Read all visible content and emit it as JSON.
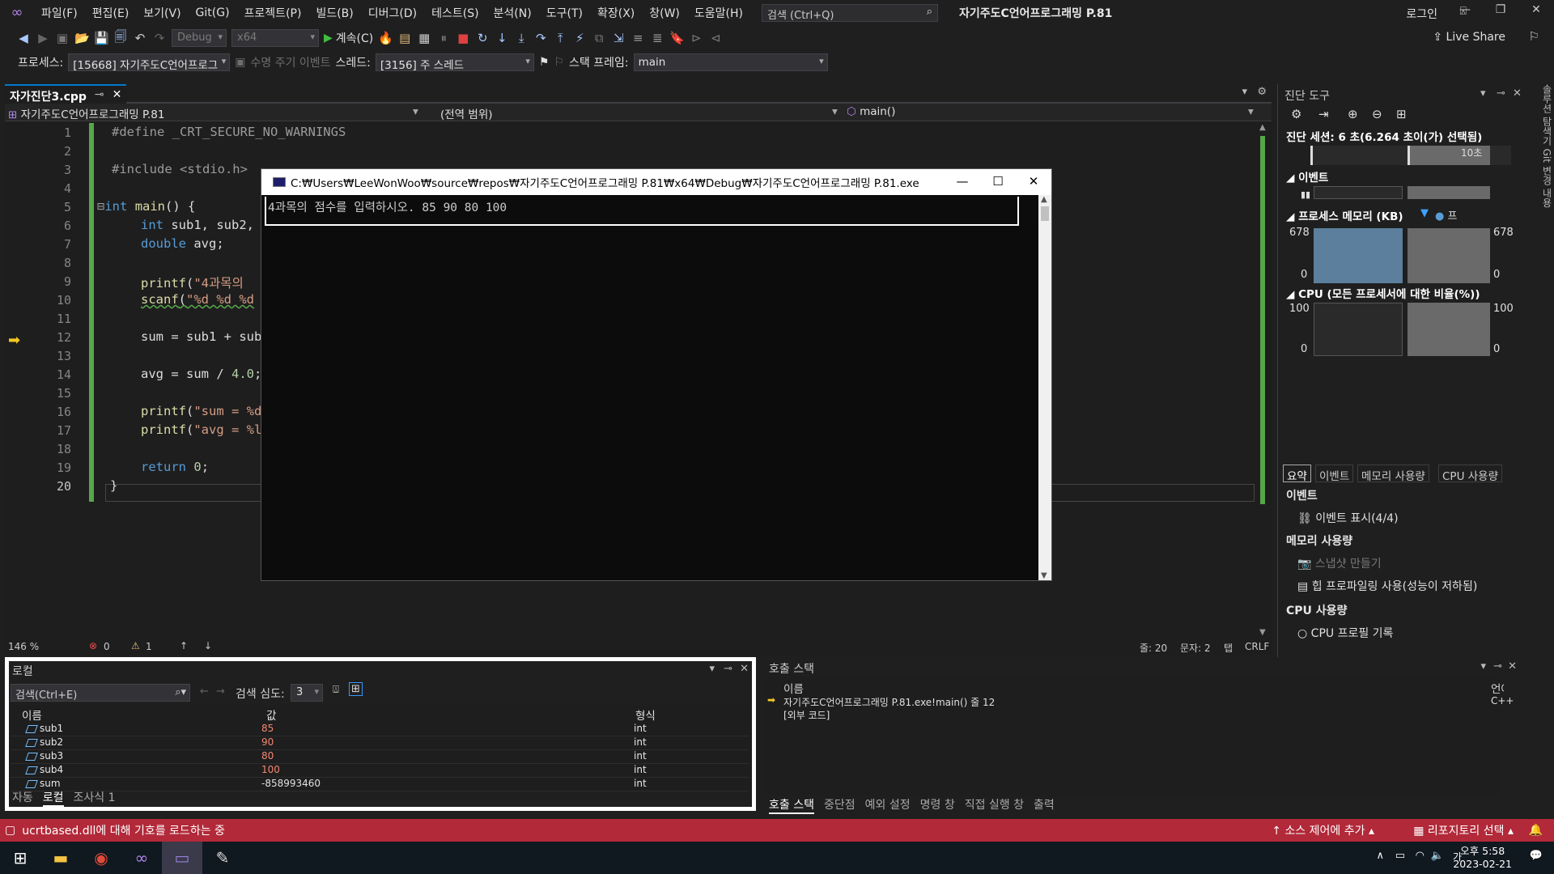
{
  "menu": {
    "items": [
      "파일(F)",
      "편집(E)",
      "보기(V)",
      "Git(G)",
      "프로젝트(P)",
      "빌드(B)",
      "디버그(D)",
      "테스트(S)",
      "분석(N)",
      "도구(T)",
      "확장(X)",
      "창(W)",
      "도움말(H)"
    ],
    "search_placeholder": "검색 (Ctrl+Q)",
    "title": "자기주도C언어프로그래밍 P.81",
    "login": "로그인",
    "live_share": "Live Share"
  },
  "toolbar": {
    "config": "Debug",
    "platform": "x64",
    "continue_label": "계속(C)"
  },
  "process_bar": {
    "process_label": "프로세스:",
    "process_value": "[15668] 자기주도C언어프로그",
    "lifecycle_label": "수명 주기 이벤트",
    "thread_label": "스레드:",
    "thread_value": "[3156] 주 스레드",
    "stackframe_label": "스택 프레임:",
    "stackframe_value": "main"
  },
  "editor": {
    "tab_name": "자가진단3.cpp",
    "nav_project": "자기주도C언어프로그래밍 P.81",
    "nav_scope": "(전역 범위)",
    "nav_function": "main()",
    "line_numbers": [
      "1",
      "2",
      "3",
      "4",
      "5",
      "6",
      "7",
      "8",
      "9",
      "10",
      "11",
      "12",
      "13",
      "14",
      "15",
      "16",
      "17",
      "18",
      "19",
      "20"
    ],
    "zoom": "146 %",
    "errors": "0",
    "warnings": "1",
    "line_info": "줄: 20",
    "col_info": "문자: 2",
    "tab_info": "탭",
    "eol": "CRLF"
  },
  "console": {
    "title": "C:₩Users₩LeeWonWoo₩source₩repos₩자기주도C언어프로그래밍 P.81₩x64₩Debug₩자기주도C언어프로그래밍 P.81.exe",
    "output": "4과목의 점수를 입력하시오. 85 90 80 100"
  },
  "diagnostics": {
    "header": "진단 도구",
    "session": "진단 세션: 6 초(6.264 초이(가) 선택됨)",
    "timeline_label": "10초",
    "events_title": "이벤트",
    "memory_title": "프로세스 메모리 (KB)",
    "memory_legend": "프",
    "memory_max": "678",
    "memory_min": "0",
    "cpu_title": "CPU (모든 프로세서에 대한 비율(%))",
    "cpu_max": "100",
    "cpu_min": "0",
    "tabs": [
      "요약",
      "이벤트",
      "메모리 사용량",
      "CPU 사용량"
    ],
    "events_header": "이벤트",
    "events_show": "이벤트 표시(4/4)",
    "mem_header": "메모리 사용량",
    "snapshot": "스냅샷 만들기",
    "heap_profiling": "힙 프로파일링 사용(성능이 저하됨)",
    "cpu_header": "CPU 사용량",
    "cpu_record": "CPU 프로필 기록"
  },
  "side_tabs": "솔루션 탐색기   Git 변경 내용",
  "locals": {
    "title": "로컬",
    "search": "검색(Ctrl+E)",
    "depth_label": "검색 심도:",
    "depth_value": "3",
    "columns": [
      "이름",
      "값",
      "형식"
    ],
    "rows": [
      {
        "name": "sub1",
        "value": "85",
        "type": "int"
      },
      {
        "name": "sub2",
        "value": "90",
        "type": "int"
      },
      {
        "name": "sub3",
        "value": "80",
        "type": "int"
      },
      {
        "name": "sub4",
        "value": "100",
        "type": "int"
      },
      {
        "name": "sum",
        "value": "-858993460",
        "type": "int"
      }
    ],
    "bottom_tabs": [
      "자동",
      "로컬",
      "조사식 1"
    ]
  },
  "callstack": {
    "title": "호출 스택",
    "col_name": "이름",
    "col_lang": "언어",
    "rows": [
      {
        "name": "자기주도C언어프로그래밍 P.81.exe!main() 줄 12",
        "lang": "C++"
      },
      {
        "name": "[외부 코드]",
        "lang": ""
      }
    ],
    "bottom_tabs": [
      "호출 스택",
      "중단점",
      "예외 설정",
      "명령 창",
      "직접 실행 창",
      "출력"
    ]
  },
  "statusbar": {
    "message": "ucrtbased.dll에 대해 기호를 로드하는 중",
    "source_control": "소스 제어에 추가",
    "repository": "리포지토리 선택"
  },
  "taskbar": {
    "time": "오후 5:58",
    "date": "2023-02-21"
  },
  "colors": {
    "accent": "#007acc",
    "status_debug": "#b22939",
    "git_bar": "#57a64a",
    "memory_bar": "#5b7f9c"
  }
}
